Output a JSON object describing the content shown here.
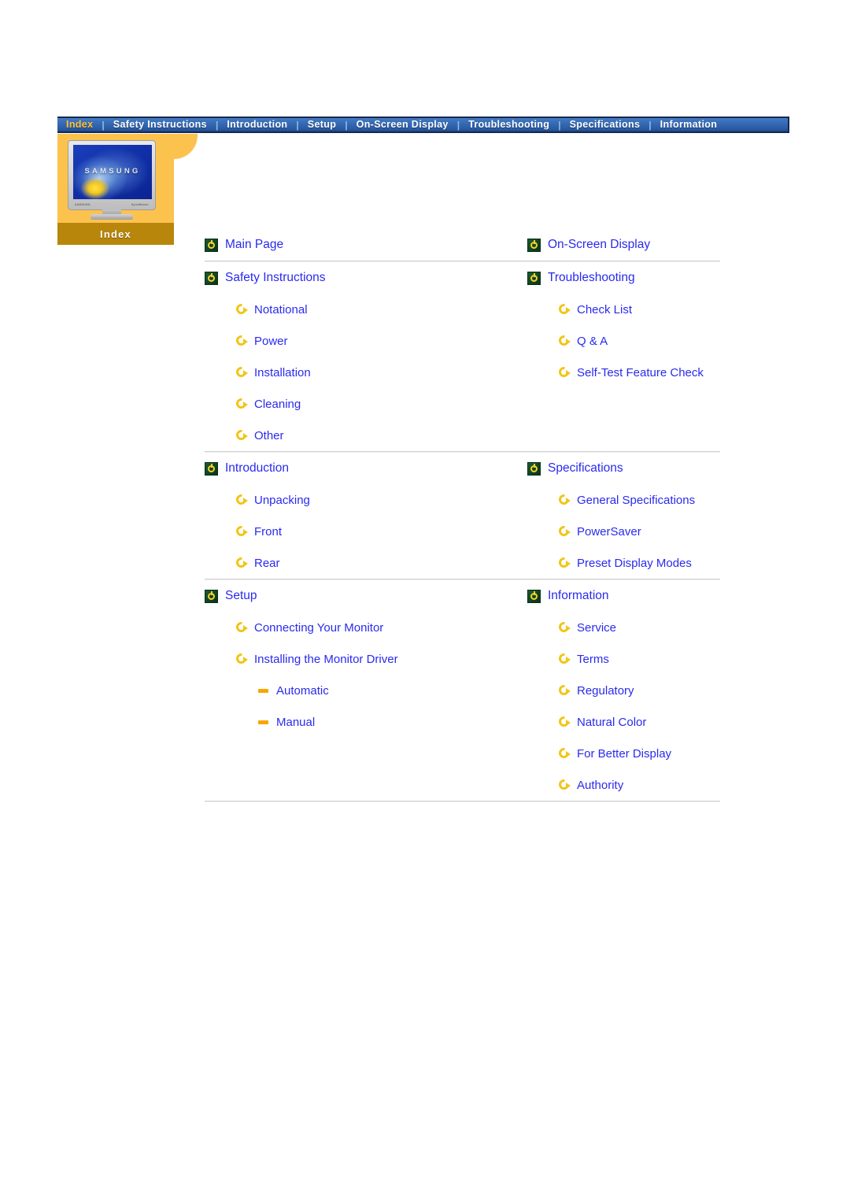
{
  "nav": {
    "items": [
      {
        "label": "Index",
        "active": true
      },
      {
        "label": "Safety Instructions",
        "active": false
      },
      {
        "label": "Introduction",
        "active": false
      },
      {
        "label": "Setup",
        "active": false
      },
      {
        "label": "On-Screen Display",
        "active": false
      },
      {
        "label": "Troubleshooting",
        "active": false
      },
      {
        "label": "Specifications",
        "active": false
      },
      {
        "label": "Information",
        "active": false
      }
    ],
    "separator": "|",
    "active_color": "#ffc13a",
    "text_color": "#ffffff"
  },
  "hero": {
    "tag_label": "Index",
    "monitor_brand": "SAMSUNG",
    "monitor_label_left": "SAMSUNG",
    "monitor_label_right": "SyncMaster",
    "panel_color": "#fcc24e",
    "tag_color": "#b8860b"
  },
  "link_color": "#2a2aee",
  "icons": {
    "main": "power-circle-icon",
    "sub": "circular-arrow-icon",
    "leaf": "dash-icon"
  },
  "index": {
    "blocks": [
      {
        "left": {
          "title": "Main Page",
          "children": []
        },
        "right": {
          "title": "On-Screen Display",
          "children": []
        }
      },
      {
        "left": {
          "title": "Safety Instructions",
          "children": [
            {
              "label": "Notational"
            },
            {
              "label": "Power"
            },
            {
              "label": "Installation"
            },
            {
              "label": "Cleaning"
            },
            {
              "label": "Other"
            }
          ]
        },
        "right": {
          "title": "Troubleshooting",
          "children": [
            {
              "label": "Check List"
            },
            {
              "label": "Q & A"
            },
            {
              "label": "Self-Test Feature Check"
            }
          ]
        }
      },
      {
        "left": {
          "title": "Introduction",
          "children": [
            {
              "label": "Unpacking"
            },
            {
              "label": "Front"
            },
            {
              "label": "Rear"
            }
          ]
        },
        "right": {
          "title": "Specifications",
          "children": [
            {
              "label": "General Specifications"
            },
            {
              "label": "PowerSaver"
            },
            {
              "label": "Preset Display Modes"
            }
          ]
        }
      },
      {
        "left": {
          "title": "Setup",
          "children": [
            {
              "label": "Connecting Your Monitor"
            },
            {
              "label": "Installing the Monitor Driver"
            },
            {
              "label": "Automatic",
              "leaf": true
            },
            {
              "label": "Manual",
              "leaf": true
            }
          ]
        },
        "right": {
          "title": "Information",
          "children": [
            {
              "label": "Service"
            },
            {
              "label": "Terms"
            },
            {
              "label": "Regulatory"
            },
            {
              "label": "Natural Color"
            },
            {
              "label": "For Better Display"
            },
            {
              "label": "Authority"
            }
          ]
        }
      }
    ]
  }
}
